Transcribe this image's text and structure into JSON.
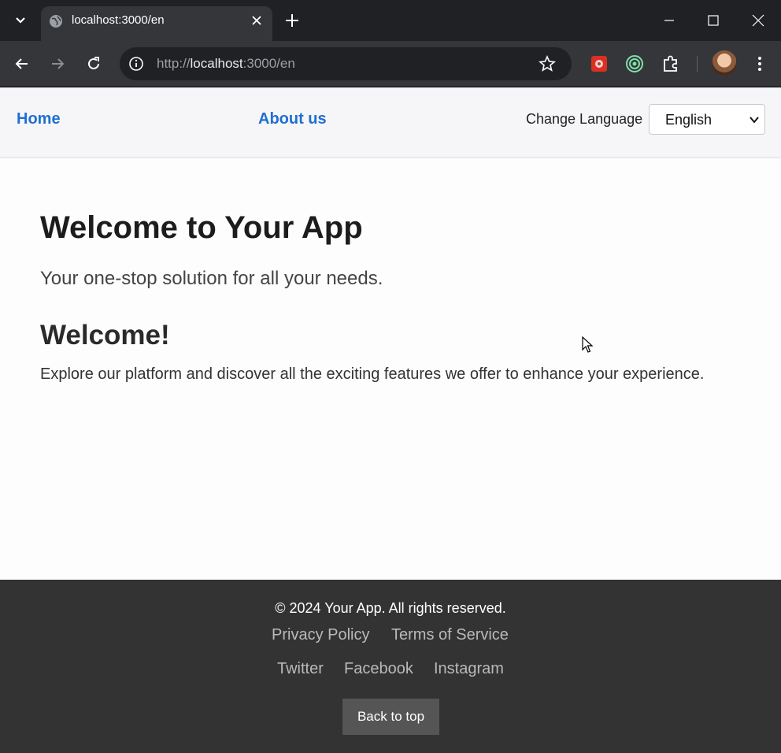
{
  "browser": {
    "tab_title": "localhost:3000/en",
    "url_scheme": "http://",
    "url_host": "localhost",
    "url_rest": ":3000/en"
  },
  "header": {
    "nav": [
      {
        "label": "Home"
      },
      {
        "label": "About us"
      }
    ],
    "language_label": "Change Language",
    "language_selected": "English"
  },
  "main": {
    "title": "Welcome to Your App",
    "subtitle": "Your one-stop solution for all your needs.",
    "welcome_heading": "Welcome!",
    "welcome_text": "Explore our platform and discover all the exciting features we offer to enhance your experience."
  },
  "footer": {
    "copyright": "© 2024 Your App. All rights reserved.",
    "legal_links": [
      {
        "label": "Privacy Policy"
      },
      {
        "label": "Terms of Service"
      }
    ],
    "social_links": [
      {
        "label": "Twitter"
      },
      {
        "label": "Facebook"
      },
      {
        "label": "Instagram"
      }
    ],
    "back_to_top": "Back to top"
  },
  "colors": {
    "link_blue": "#1f6fd1",
    "footer_bg": "#333333",
    "chrome_dark": "#202124"
  }
}
